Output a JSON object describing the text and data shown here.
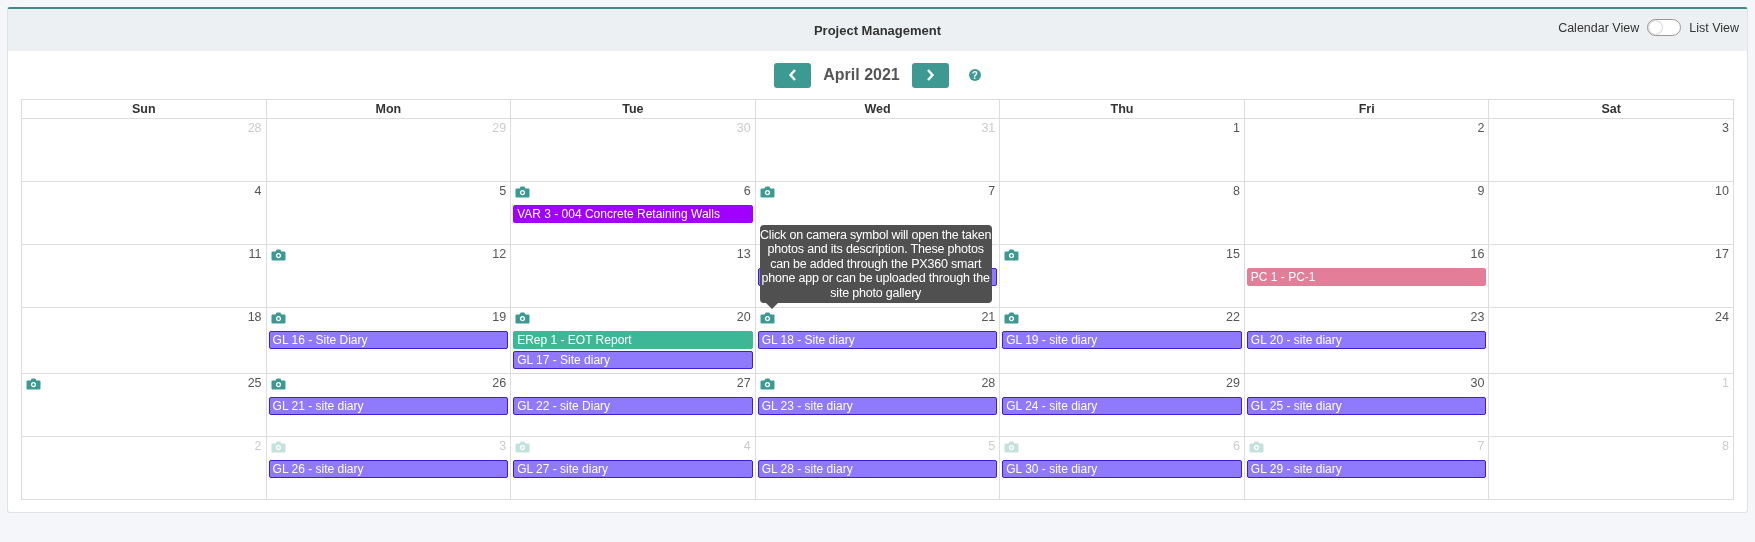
{
  "panel": {
    "title": "Project Management"
  },
  "view_toggle": {
    "left_label": "Calendar View",
    "right_label": "List View",
    "on": false
  },
  "nav": {
    "month": "April 2021",
    "help": "?"
  },
  "calendar": {
    "weekdays": [
      "Sun",
      "Mon",
      "Tue",
      "Wed",
      "Thu",
      "Fri",
      "Sat"
    ],
    "weeks": [
      [
        {
          "day": "28",
          "muted": true
        },
        {
          "day": "29",
          "muted": true
        },
        {
          "day": "30",
          "muted": true
        },
        {
          "day": "31",
          "muted": true
        },
        {
          "day": "1",
          "muted": false
        },
        {
          "day": "2",
          "muted": false
        },
        {
          "day": "3",
          "muted": false
        }
      ],
      [
        {
          "day": "4",
          "muted": false
        },
        {
          "day": "5",
          "muted": false
        },
        {
          "day": "6",
          "muted": false,
          "camera": true,
          "events": [
            {
              "label": "VAR 3 - 004 Concrete Retaining Walls",
              "color": "#a100ff"
            }
          ]
        },
        {
          "day": "7",
          "muted": false,
          "camera": true
        },
        {
          "day": "8",
          "muted": false
        },
        {
          "day": "9",
          "muted": false
        },
        {
          "day": "10",
          "muted": false
        }
      ],
      [
        {
          "day": "11",
          "muted": false
        },
        {
          "day": "12",
          "muted": false,
          "camera": true
        },
        {
          "day": "13",
          "muted": false
        },
        {
          "events": [
            {
              "color": "#8f79fc"
            }
          ]
        },
        {
          "day": "15",
          "muted": false,
          "camera": true
        },
        {
          "day": "16",
          "muted": false,
          "events": [
            {
              "label": "PC 1 - PC-1",
              "color": "#e37d98"
            }
          ]
        },
        {
          "day": "17",
          "muted": false
        }
      ],
      [
        {
          "day": "18",
          "muted": false
        },
        {
          "day": "19",
          "muted": false,
          "camera": true,
          "events": [
            {
              "label": "GL 16 - Site Diary",
              "color": "#8f79fc"
            }
          ]
        },
        {
          "day": "20",
          "muted": false,
          "camera": true,
          "events": [
            {
              "label": "ERep 1 - EOT Report",
              "color": "#3cb896"
            },
            {
              "label": "GL 17 - Site diary",
              "color": "#8f79fc"
            }
          ]
        },
        {
          "day": "21",
          "muted": false,
          "camera": true,
          "tooltip": "Click on camera symbol will open the taken photos and its description. These photos can be added through the PX360 smart phone app or can be uploaded through the site photo gallery",
          "events": [
            {
              "label": "GL 18 - Site diary",
              "color": "#8f79fc"
            }
          ]
        },
        {
          "day": "22",
          "muted": false,
          "camera": true,
          "events": [
            {
              "label": "GL 19 - site diary",
              "color": "#8f79fc"
            }
          ]
        },
        {
          "day": "23",
          "muted": false,
          "events": [
            {
              "label": "GL 20 - site diary",
              "color": "#8f79fc"
            }
          ]
        },
        {
          "day": "24",
          "muted": false
        }
      ],
      [
        {
          "day": "25",
          "muted": false,
          "camera": true
        },
        {
          "day": "26",
          "muted": false,
          "camera": true,
          "events": [
            {
              "label": "GL 21 - site diary",
              "color": "#8f79fc"
            }
          ]
        },
        {
          "day": "27",
          "muted": false,
          "events": [
            {
              "label": "GL 22 - site Diary",
              "color": "#8f79fc"
            }
          ]
        },
        {
          "day": "28",
          "muted": false,
          "camera": true,
          "events": [
            {
              "label": "GL 23 - site diary",
              "color": "#8f79fc"
            }
          ]
        },
        {
          "day": "29",
          "muted": false,
          "events": [
            {
              "label": "GL 24 - site diary",
              "color": "#8f79fc"
            }
          ]
        },
        {
          "day": "30",
          "muted": false,
          "events": [
            {
              "label": "GL 25 - site diary",
              "color": "#8f79fc"
            }
          ]
        },
        {
          "day": "1",
          "muted": true
        }
      ],
      [
        {
          "day": "2",
          "muted": true
        },
        {
          "day": "3",
          "muted": true,
          "camera": true,
          "events": [
            {
              "label": "GL 26 - site diary",
              "color": "#8f79fc"
            }
          ]
        },
        {
          "day": "4",
          "muted": true,
          "camera": true,
          "events": [
            {
              "label": "GL 27 - site diary",
              "color": "#8f79fc"
            }
          ]
        },
        {
          "day": "5",
          "muted": true,
          "events": [
            {
              "label": "GL 28 - site diary",
              "color": "#8f79fc"
            }
          ]
        },
        {
          "day": "6",
          "muted": true,
          "camera": true,
          "events": [
            {
              "label": "GL 30 - site diary",
              "color": "#8f79fc"
            }
          ]
        },
        {
          "day": "7",
          "muted": true,
          "camera": true,
          "events": [
            {
              "label": "GL 29 - site diary",
              "color": "#8f79fc"
            }
          ]
        },
        {
          "day": "8",
          "muted": true
        }
      ]
    ]
  }
}
